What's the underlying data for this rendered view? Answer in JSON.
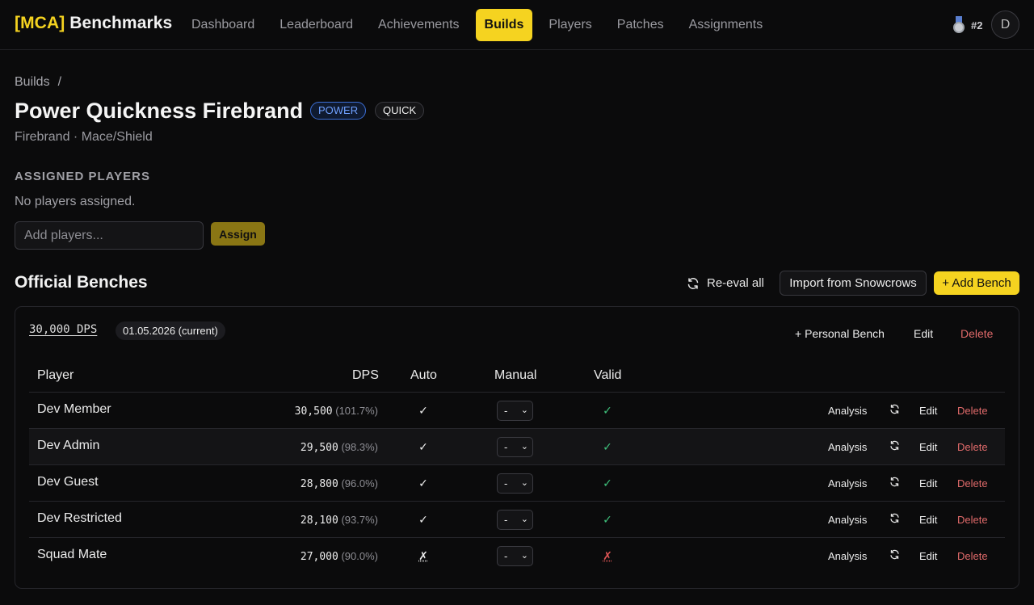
{
  "brand": {
    "tag": "[MCA]",
    "name": "Benchmarks"
  },
  "nav": {
    "items": [
      {
        "label": "Dashboard",
        "active": false
      },
      {
        "label": "Leaderboard",
        "active": false
      },
      {
        "label": "Achievements",
        "active": false
      },
      {
        "label": "Builds",
        "active": true
      },
      {
        "label": "Players",
        "active": false
      },
      {
        "label": "Patches",
        "active": false
      },
      {
        "label": "Assignments",
        "active": false
      }
    ],
    "rank": "#2",
    "rank_icon": "medal-icon",
    "avatar_initial": "D"
  },
  "breadcrumb": {
    "root": "Builds",
    "separator": "/"
  },
  "build": {
    "title": "Power Quickness Firebrand",
    "badges": {
      "type": "POWER",
      "boon": "QUICK"
    },
    "subtitle": "Firebrand · Mace/Shield"
  },
  "assigned": {
    "label": "ASSIGNED PLAYERS",
    "empty_text": "No players assigned.",
    "input_placeholder": "Add players...",
    "assign_label": "Assign"
  },
  "benches": {
    "heading": "Official Benches",
    "reeval_label": "Re-eval all",
    "import_label": "Import from Snowcrows",
    "add_label": "+ Add Bench",
    "card": {
      "dps": "30,000 DPS",
      "date": "01.05.2026 (current)",
      "personal_label": "+ Personal Bench",
      "edit_label": "Edit",
      "delete_label": "Delete",
      "columns": {
        "player": "Player",
        "dps": "DPS",
        "auto": "Auto",
        "manual": "Manual",
        "valid": "Valid"
      },
      "rows": [
        {
          "player": "Dev Member",
          "dps": "30,500",
          "pct": "(101.7%)",
          "auto": "✓",
          "manual": "-",
          "valid": "✓",
          "analysis": "Analysis",
          "edit": "Edit",
          "delete": "Delete"
        },
        {
          "player": "Dev Admin",
          "dps": "29,500",
          "pct": "(98.3%)",
          "auto": "✓",
          "manual": "-",
          "valid": "✓",
          "analysis": "Analysis",
          "edit": "Edit",
          "delete": "Delete"
        },
        {
          "player": "Dev Guest",
          "dps": "28,800",
          "pct": "(96.0%)",
          "auto": "✓",
          "manual": "-",
          "valid": "✓",
          "analysis": "Analysis",
          "edit": "Edit",
          "delete": "Delete"
        },
        {
          "player": "Dev Restricted",
          "dps": "28,100",
          "pct": "(93.7%)",
          "auto": "✓",
          "manual": "-",
          "valid": "✓",
          "analysis": "Analysis",
          "edit": "Edit",
          "delete": "Delete"
        },
        {
          "player": "Squad Mate",
          "dps": "27,000",
          "pct": "(90.0%)",
          "auto": "✗",
          "manual": "-",
          "valid": "✗",
          "analysis": "Analysis",
          "edit": "Edit",
          "delete": "Delete"
        }
      ]
    }
  },
  "colors": {
    "accent": "#f5d320",
    "valid": "#3fc27c",
    "invalid": "#e05555",
    "danger": "#e06a6a",
    "power_badge": "#6fa0ff"
  }
}
